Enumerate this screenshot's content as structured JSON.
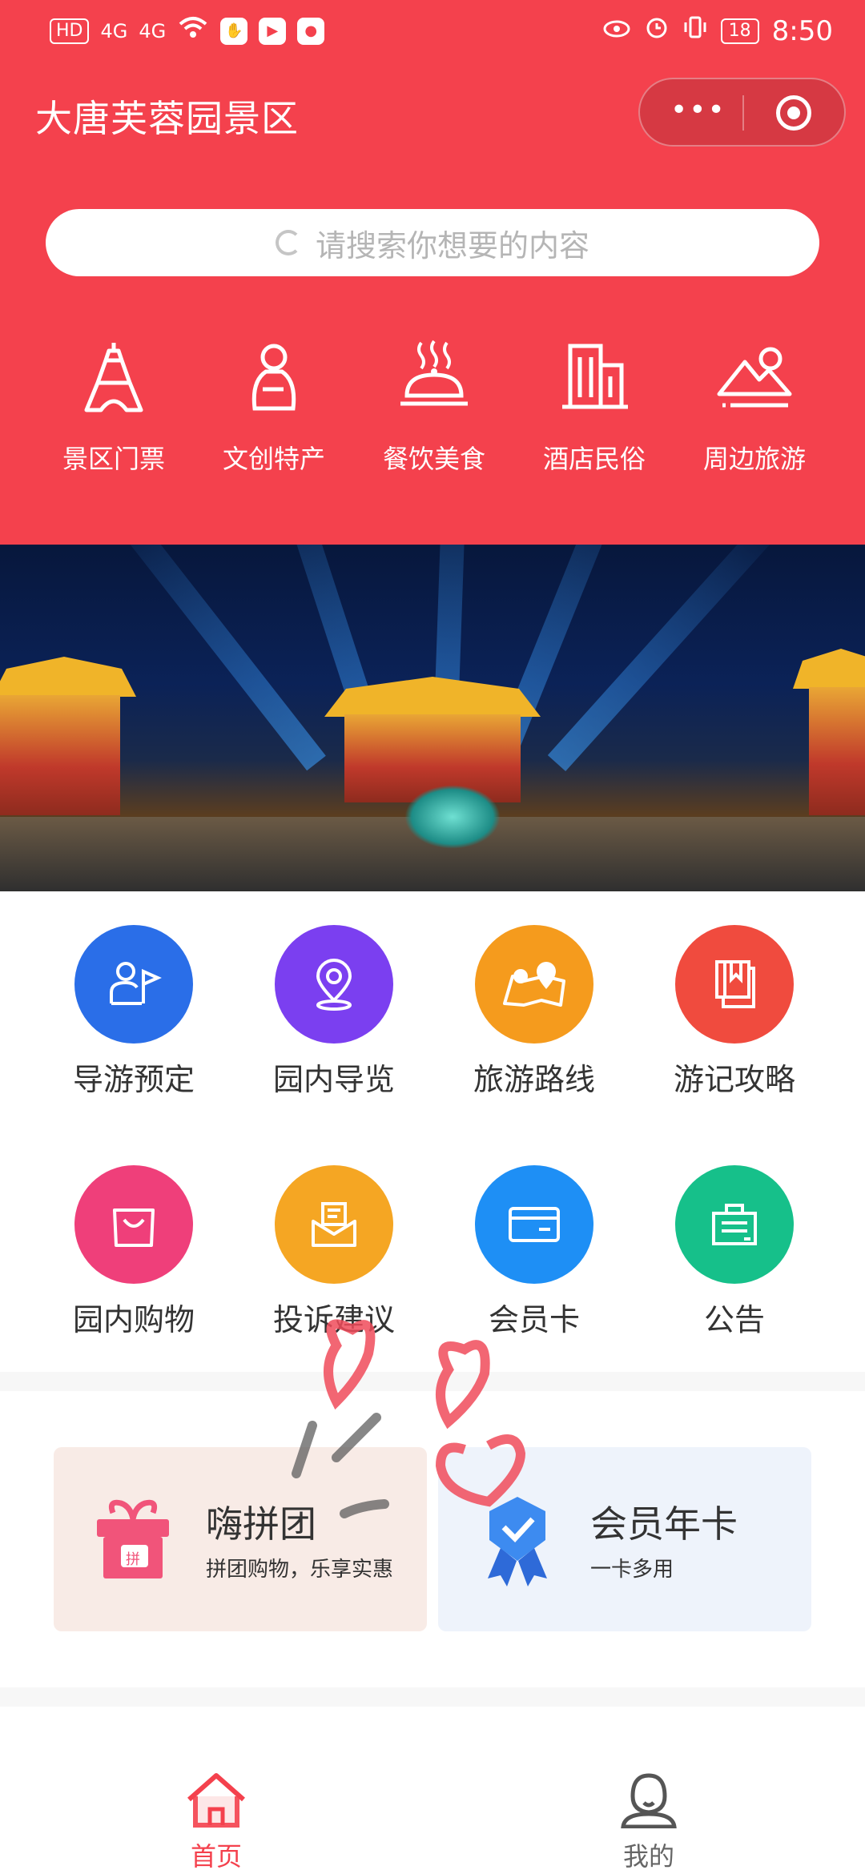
{
  "status_bar": {
    "network_badge": "HD",
    "signal_1": "4G",
    "signal_2": "4G",
    "battery": "18",
    "time": "8:50"
  },
  "header": {
    "title": "大唐芙蓉园景区",
    "search_placeholder": "请搜索你想要的内容",
    "menu_dots": "•••",
    "categories": [
      {
        "label": "景区门票",
        "icon": "eiffel-tower-icon"
      },
      {
        "label": "文创特产",
        "icon": "figure-icon"
      },
      {
        "label": "餐饮美食",
        "icon": "food-cloche-icon"
      },
      {
        "label": "酒店民俗",
        "icon": "hotel-building-icon"
      },
      {
        "label": "周边旅游",
        "icon": "mountain-icon"
      }
    ],
    "bg_color": "#f4414d"
  },
  "grid": {
    "items": [
      {
        "label": "导游预定",
        "icon": "guide-flag-icon",
        "color": "#2a6ee8"
      },
      {
        "label": "园内导览",
        "icon": "location-pin-icon",
        "color": "#7b3ff0"
      },
      {
        "label": "旅游路线",
        "icon": "map-route-icon",
        "color": "#f59b1d"
      },
      {
        "label": "游记攻略",
        "icon": "book-icon",
        "color": "#f04b3e"
      },
      {
        "label": "园内购物",
        "icon": "shopping-bag-icon",
        "color": "#ef3f7a"
      },
      {
        "label": "投诉建议",
        "icon": "mail-icon",
        "color": "#f5a623"
      },
      {
        "label": "会员卡",
        "icon": "card-icon",
        "color": "#1e8ff5"
      },
      {
        "label": "公告",
        "icon": "notice-board-icon",
        "color": "#16c08a"
      }
    ]
  },
  "promo": {
    "group": {
      "title": "嗨拼团",
      "subtitle": "拼团购物，乐享实惠",
      "badge": "拼"
    },
    "member": {
      "title": "会员年卡",
      "subtitle": "一卡多用"
    }
  },
  "tabbar": {
    "home": "首页",
    "mine": "我的",
    "active_color": "#f4414d"
  }
}
